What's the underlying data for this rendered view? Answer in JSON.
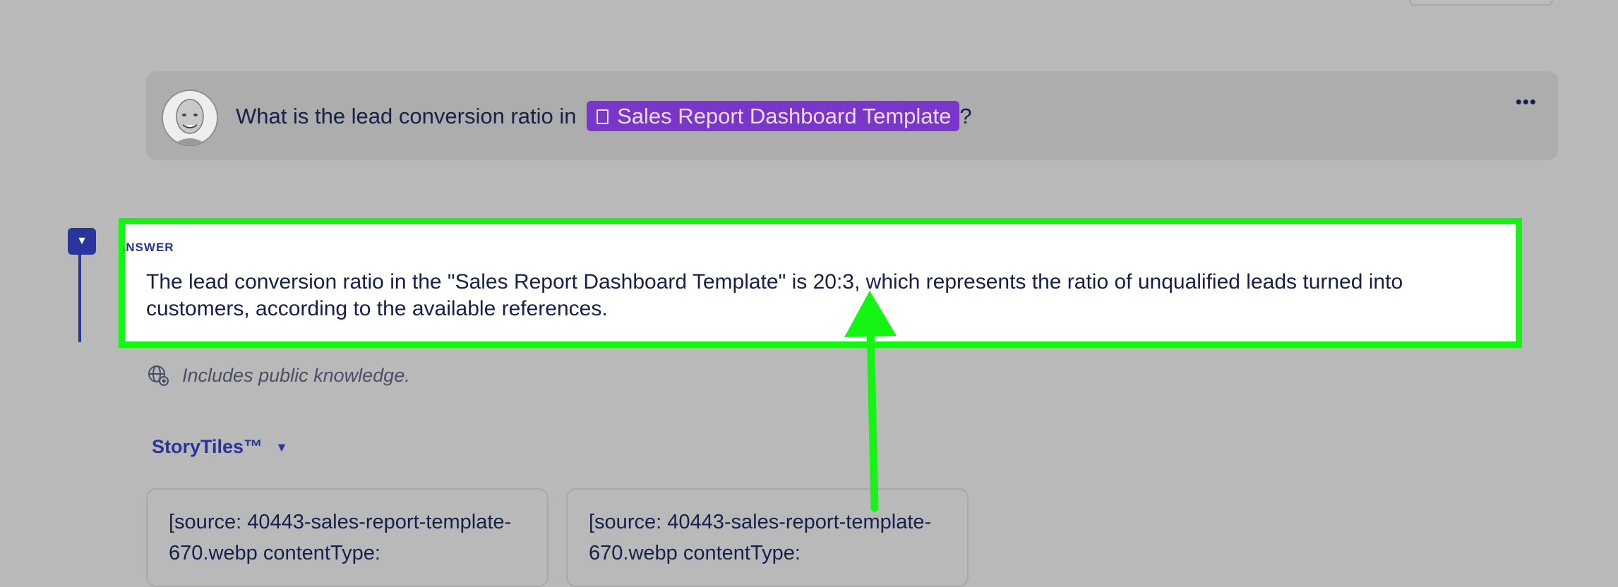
{
  "question": {
    "prefix": "What is the lead conversion ratio in ",
    "document_chip": "Sales Report Dashboard Template",
    "suffix": "?",
    "more_label": "•••"
  },
  "answer": {
    "label": "ANSWER",
    "toggle_icon": "▼",
    "text": "The lead conversion ratio in the \"Sales Report Dashboard Template\" is 20:3, which represents the ratio of unqualified leads turned into customers, according to the available references."
  },
  "public_note": "Includes public knowledge.",
  "storytiles": {
    "label": "StoryTiles™",
    "caret": "▼",
    "tiles": [
      {
        "text": "[source: 40443-sales-report-template-670.webp contentType:"
      },
      {
        "text": "[source: 40443-sales-report-template-670.webp contentType:"
      }
    ]
  },
  "colors": {
    "highlight": "#14f514",
    "accent": "#27359c",
    "chip": "#7a35c9"
  },
  "icons": [
    "avatar",
    "document-icon",
    "more-icon",
    "toggle-caret-icon",
    "globe-icon",
    "caret-down-icon",
    "arrow-annotation"
  ]
}
